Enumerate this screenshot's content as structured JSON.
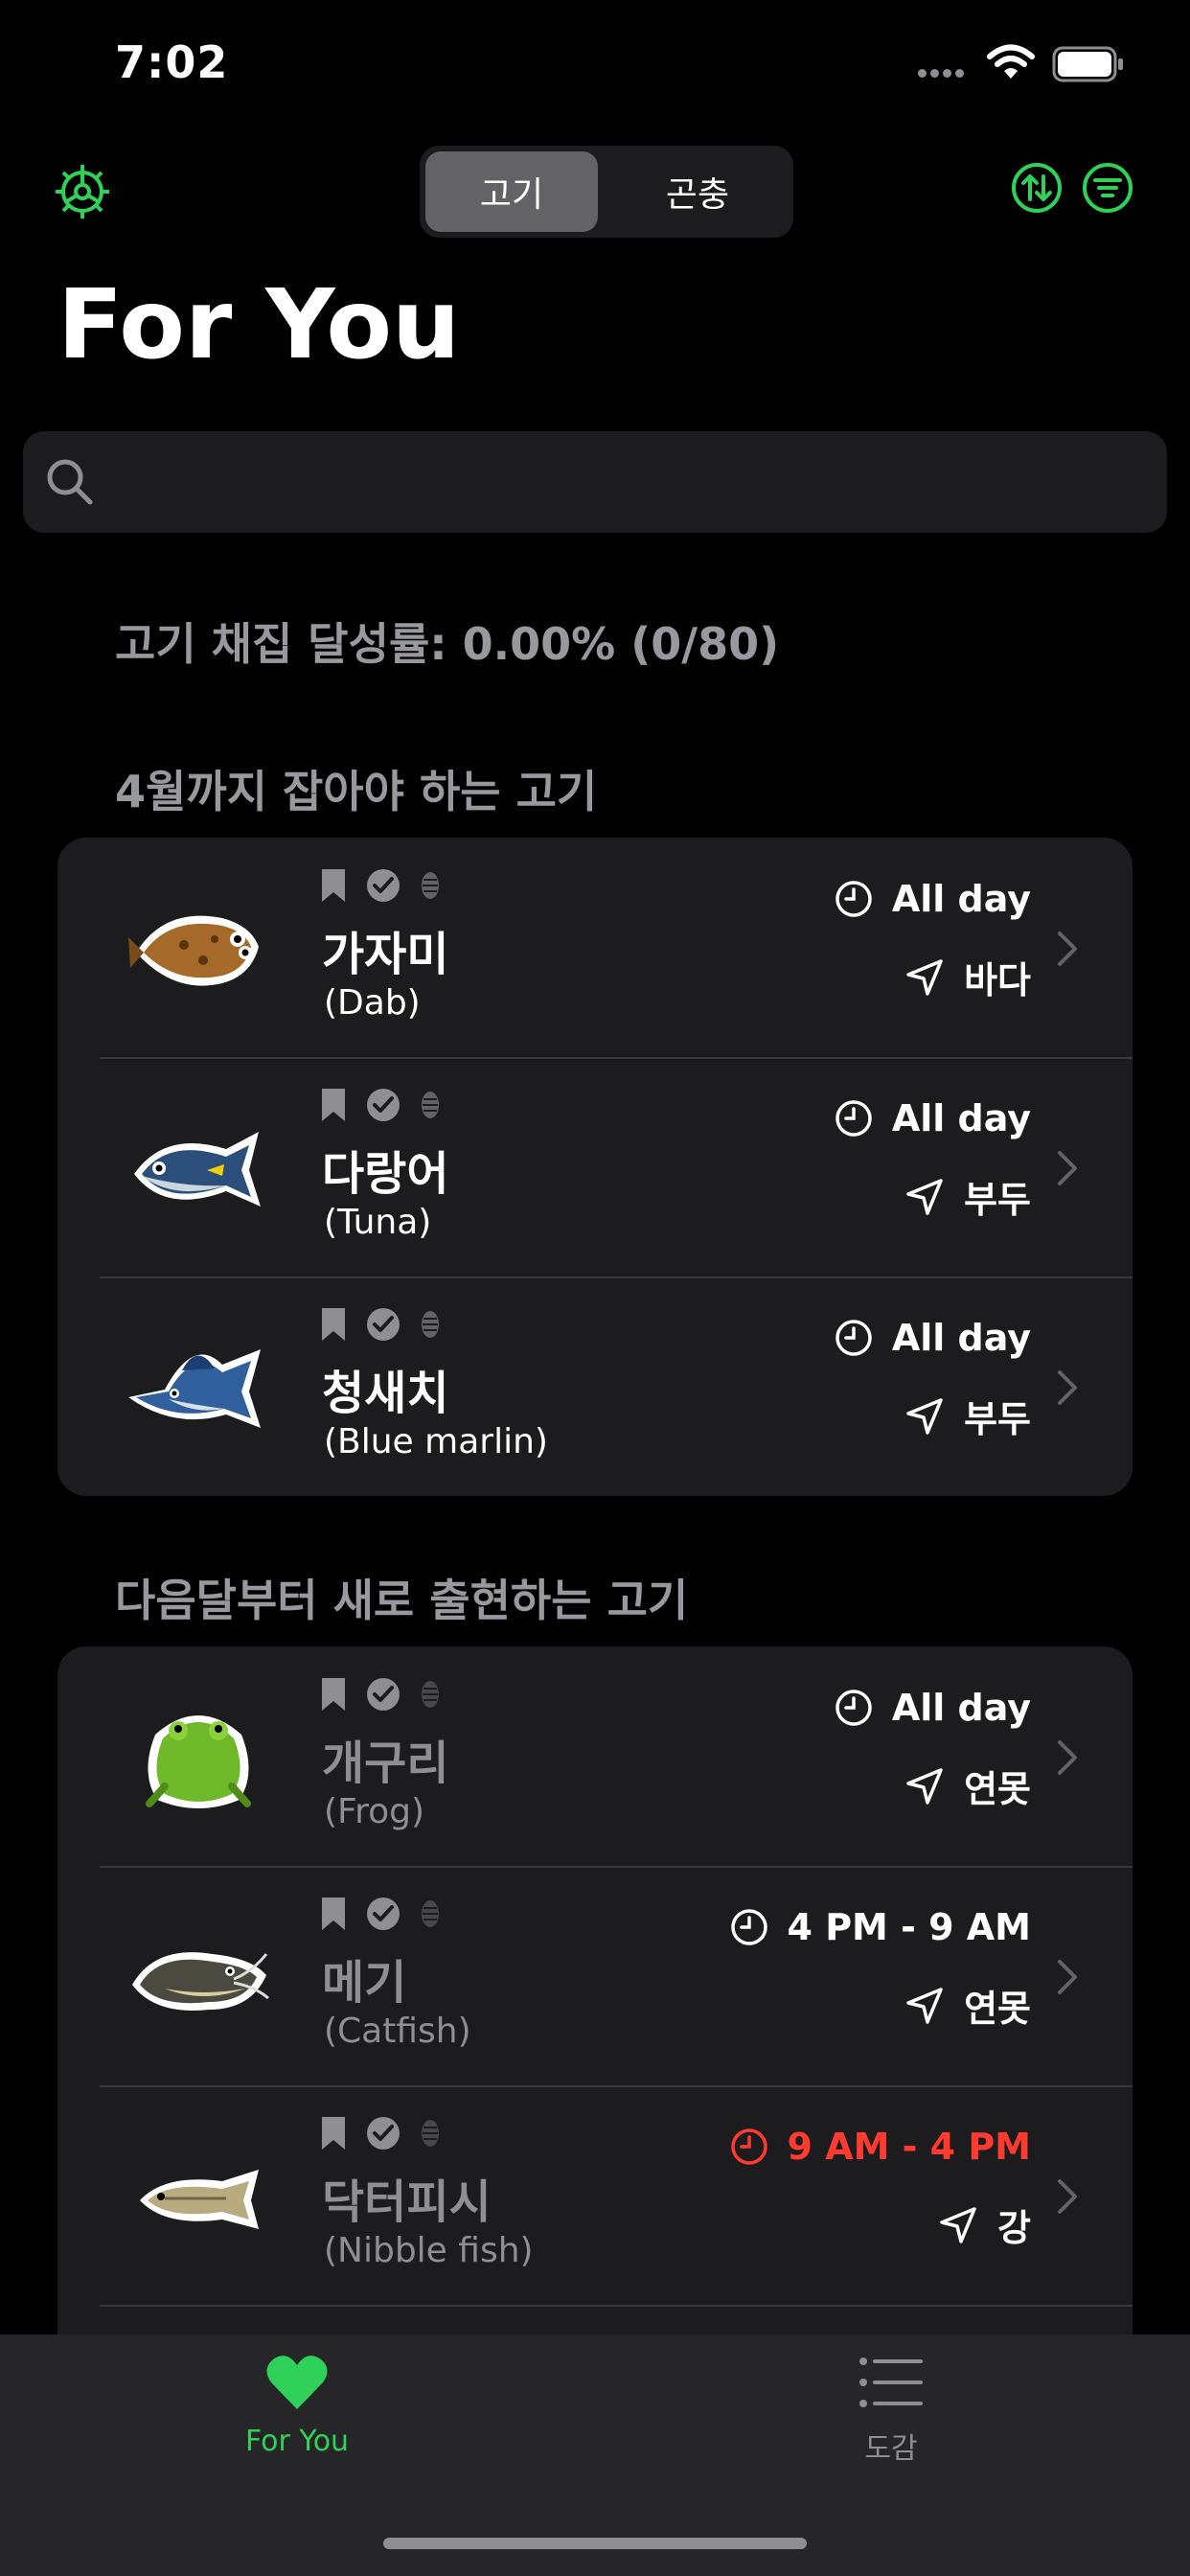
{
  "status_bar": {
    "time": "7:02"
  },
  "segmented": {
    "options": [
      "고기",
      "곤충"
    ],
    "selected": "고기"
  },
  "page_title": "For You",
  "search": {
    "placeholder": ""
  },
  "progress_label": "고기 채집 달성률:  0.00% (0/80)",
  "sections": [
    {
      "title": "4월까지 잡아야 하는 고기",
      "items": [
        {
          "name": "가자미",
          "subtitle": "(Dab)",
          "time": "All day",
          "location": "바다",
          "time_highlight": false,
          "muted": false
        },
        {
          "name": "다랑어",
          "subtitle": "(Tuna)",
          "time": "All day",
          "location": "부두",
          "time_highlight": false,
          "muted": false
        },
        {
          "name": "청새치",
          "subtitle": "(Blue marlin)",
          "time": "All day",
          "location": "부두",
          "time_highlight": false,
          "muted": false
        }
      ]
    },
    {
      "title": "다음달부터 새로 출현하는 고기",
      "items": [
        {
          "name": "개구리",
          "subtitle": "(Frog)",
          "time": "All day",
          "location": "연못",
          "time_highlight": false,
          "muted": true
        },
        {
          "name": "메기",
          "subtitle": "(Catfish)",
          "time": "4 PM - 9 AM",
          "location": "연못",
          "time_highlight": false,
          "muted": true
        },
        {
          "name": "닥터피시",
          "subtitle": "(Nibble fish)",
          "time": "9 AM - 4 PM",
          "location": "강",
          "time_highlight": true,
          "muted": true
        }
      ]
    }
  ],
  "tabbar": {
    "items": [
      {
        "label": "For You",
        "active": true
      },
      {
        "label": "도감",
        "active": false
      }
    ]
  },
  "colors": {
    "accent": "#30d158",
    "highlight": "#ff3b30",
    "card": "#1c1c1e",
    "tabbar": "#262628"
  },
  "icons": [
    "gear-icon",
    "sort-icon",
    "filter-icon",
    "search-icon",
    "bookmark-icon",
    "checkmark-icon",
    "fossil-icon",
    "clock-icon",
    "location-arrow-icon",
    "chevron-right-icon",
    "heart-icon",
    "list-icon"
  ]
}
